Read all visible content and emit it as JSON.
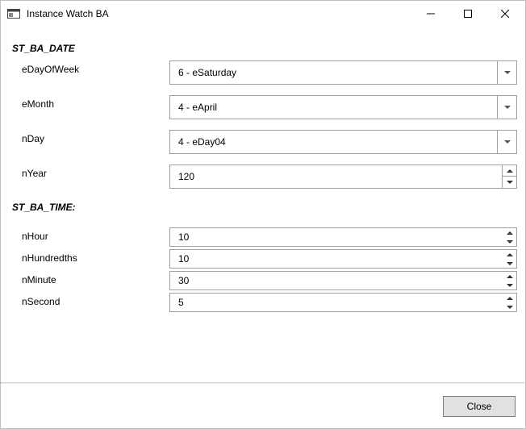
{
  "window": {
    "title": "Instance Watch BA"
  },
  "sections": {
    "date": {
      "title": "ST_BA_DATE",
      "fields": {
        "eDayOfWeek": {
          "label": "eDayOfWeek",
          "value": "6 - eSaturday"
        },
        "eMonth": {
          "label": "eMonth",
          "value": "4 - eApril"
        },
        "nDay": {
          "label": "nDay",
          "value": "4 - eDay04"
        },
        "nYear": {
          "label": "nYear",
          "value": "120"
        }
      }
    },
    "time": {
      "title": "ST_BA_TIME:",
      "fields": {
        "nHour": {
          "label": "nHour",
          "value": "10"
        },
        "nHundredths": {
          "label": "nHundredths",
          "value": "10"
        },
        "nMinute": {
          "label": "nMinute",
          "value": "30"
        },
        "nSecond": {
          "label": "nSecond",
          "value": "5"
        }
      }
    }
  },
  "footer": {
    "close_label": "Close"
  }
}
